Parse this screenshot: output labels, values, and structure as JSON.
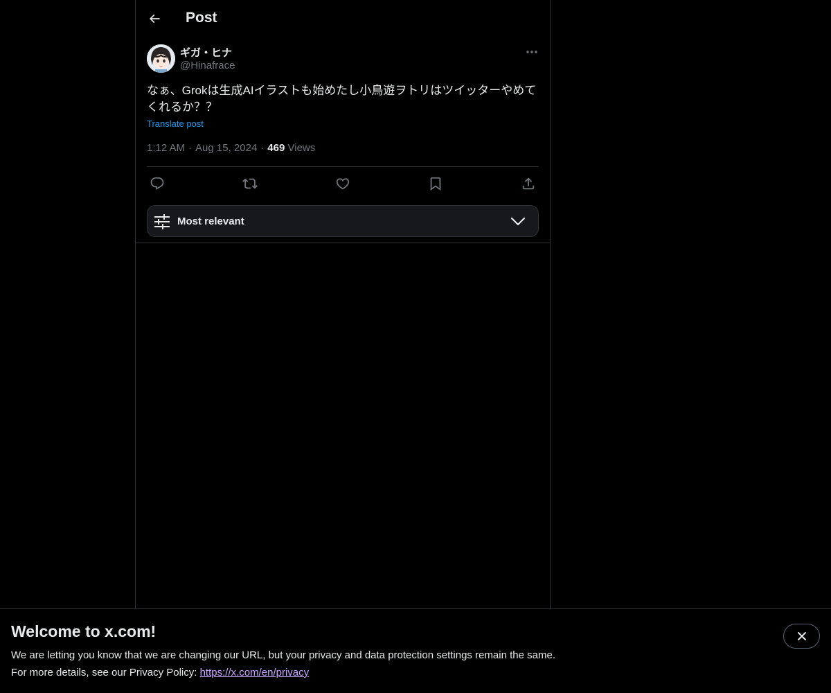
{
  "header": {
    "title": "Post",
    "back_icon": "arrow-left-icon"
  },
  "post": {
    "author": {
      "display_name": "ギガ・ヒナ",
      "handle": "@Hinafrace",
      "avatar_icon": "avatar-image"
    },
    "text": "なぁ、Grokは生成AIイラストも始めたし小鳥遊ヲトリはツイッターやめてくれるか？？",
    "translate_label": "Translate post",
    "time": "1:12 AM",
    "date": "Aug 15, 2024",
    "views_count": "469",
    "views_label": "Views",
    "separator": "·"
  },
  "actions": [
    {
      "name": "reply",
      "icon": "reply-icon"
    },
    {
      "name": "repost",
      "icon": "repost-icon"
    },
    {
      "name": "like",
      "icon": "heart-icon"
    },
    {
      "name": "bookmark",
      "icon": "bookmark-icon"
    },
    {
      "name": "share",
      "icon": "share-icon"
    }
  ],
  "sort": {
    "label": "Most relevant",
    "icon": "sliders-icon"
  },
  "banner": {
    "title": "Welcome to x.com!",
    "line1": "We are letting you know that we are changing our URL, but your privacy and data protection settings remain the same.",
    "line2_prefix": "For more details, see our Privacy Policy: ",
    "link_text": "https://x.com/en/privacy",
    "close_icon": "close-icon"
  },
  "colors": {
    "background": "#000000",
    "text": "#e7e9ea",
    "muted": "#71767b",
    "accent": "#1d9bf0",
    "border": "#2f3336",
    "link_visited": "#c9a6ff"
  }
}
